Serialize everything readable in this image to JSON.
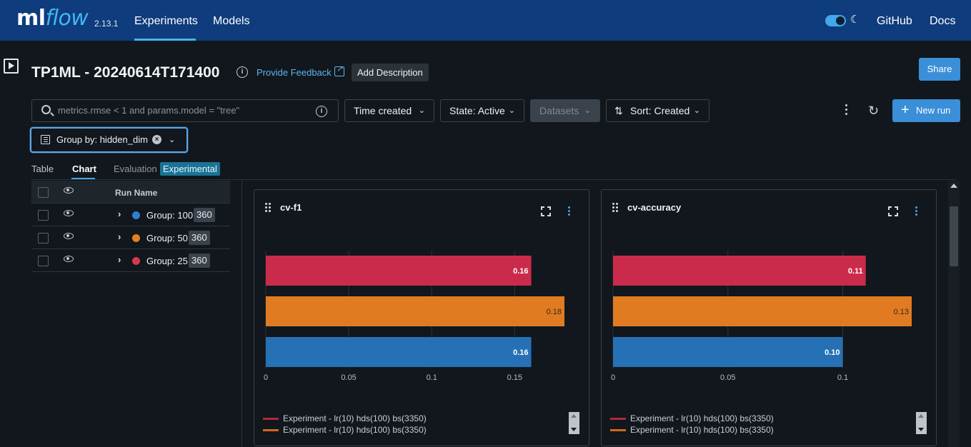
{
  "app": {
    "logo_ml": "ml",
    "logo_flow": "flow",
    "version": "2.13.1",
    "nav": {
      "experiments": "Experiments",
      "models": "Models",
      "github": "GitHub",
      "docs": "Docs"
    },
    "accent_color": "#43b6f2",
    "header_bg": "#0e3c7d"
  },
  "experiment": {
    "title": "TP1ML - 20240614T171400",
    "feedback_link": "Provide Feedback",
    "add_description": "Add Description",
    "share": "Share"
  },
  "filters": {
    "search_placeholder": "metrics.rmse < 1 and params.model = \"tree\"",
    "time_created": "Time created",
    "state": "State: Active",
    "datasets": "Datasets",
    "sort": "Sort: Created",
    "new_run": "New run",
    "group_by": "Group by: hidden_dim"
  },
  "tabs": {
    "table": "Table",
    "chart": "Chart",
    "evaluation": "Evaluation",
    "experimental": "Experimental"
  },
  "runs": {
    "header": "Run Name",
    "groups": [
      {
        "label": "Group: 100",
        "count": "360",
        "color": "#2f7fd0"
      },
      {
        "label": "Group: 50",
        "count": "360",
        "color": "#e67e22"
      },
      {
        "label": "Group: 25",
        "count": "360",
        "color": "#d6374f"
      }
    ]
  },
  "charts": {
    "legend": [
      {
        "label": "Experiment - lr(10) hds(100) bs(3350)",
        "color": "#b5263d"
      },
      {
        "label": "Experiment - lr(10) hds(100) bs(3350)",
        "color": "#d36a1a"
      }
    ]
  },
  "chart_data": [
    {
      "type": "bar",
      "orientation": "horizontal",
      "title": "cv-f1",
      "categories": [
        "Group: 25",
        "Group: 50",
        "Group: 100"
      ],
      "values": [
        0.16,
        0.18,
        0.16
      ],
      "value_labels": [
        "0.16",
        "0.18",
        "0.16"
      ],
      "colors": [
        "#cb2b4a",
        "#e07b22",
        "#2670b6"
      ],
      "xticks": [
        "0",
        "0.05",
        "0.1",
        "0.15"
      ],
      "xlim": [
        0,
        0.18
      ]
    },
    {
      "type": "bar",
      "orientation": "horizontal",
      "title": "cv-accuracy",
      "categories": [
        "Group: 25",
        "Group: 50",
        "Group: 100"
      ],
      "values": [
        0.11,
        0.13,
        0.1
      ],
      "value_labels": [
        "0.11",
        "0.13",
        "0.10"
      ],
      "colors": [
        "#cb2b4a",
        "#e07b22",
        "#2670b6"
      ],
      "xticks": [
        "0",
        "0.05",
        "0.1"
      ],
      "xlim": [
        0,
        0.13
      ]
    }
  ]
}
